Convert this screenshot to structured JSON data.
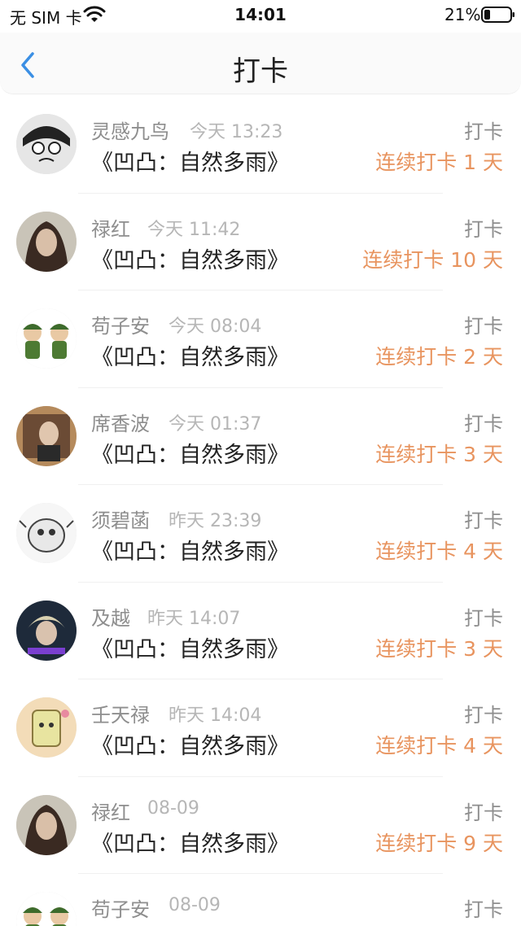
{
  "status": {
    "carrier": "无 SIM 卡",
    "time": "14:01",
    "battery": "21%"
  },
  "nav": {
    "title": "打卡",
    "back_icon": "chevron-left-icon"
  },
  "colors": {
    "accent_blue": "#3b8fe4",
    "streak_orange": "#e8945f",
    "text_gray": "#8e8e8e"
  },
  "items": [
    {
      "name": "灵感九鸟",
      "time": "今天 13:23",
      "book": "《凹凸：自然多雨》",
      "action": "打卡",
      "streak": "连续打卡 1 天"
    },
    {
      "name": "禄红",
      "time": "今天 11:42",
      "book": "《凹凸：自然多雨》",
      "action": "打卡",
      "streak": "连续打卡 10 天"
    },
    {
      "name": "苟子安",
      "time": "今天 08:04",
      "book": "《凹凸：自然多雨》",
      "action": "打卡",
      "streak": "连续打卡 2 天"
    },
    {
      "name": "席香波",
      "time": "今天 01:37",
      "book": "《凹凸：自然多雨》",
      "action": "打卡",
      "streak": "连续打卡 3 天"
    },
    {
      "name": "须碧菡",
      "time": "昨天 23:39",
      "book": "《凹凸：自然多雨》",
      "action": "打卡",
      "streak": "连续打卡 4 天"
    },
    {
      "name": "及越",
      "time": "昨天 14:07",
      "book": "《凹凸：自然多雨》",
      "action": "打卡",
      "streak": "连续打卡 3 天"
    },
    {
      "name": "壬天禄",
      "time": "昨天 14:04",
      "book": "《凹凸：自然多雨》",
      "action": "打卡",
      "streak": "连续打卡 4 天"
    },
    {
      "name": "禄红",
      "time": "08-09",
      "book": "《凹凸：自然多雨》",
      "action": "打卡",
      "streak": "连续打卡 9 天"
    },
    {
      "name": "苟子安",
      "time": "08-09",
      "book": "",
      "action": "打卡",
      "streak": ""
    }
  ]
}
